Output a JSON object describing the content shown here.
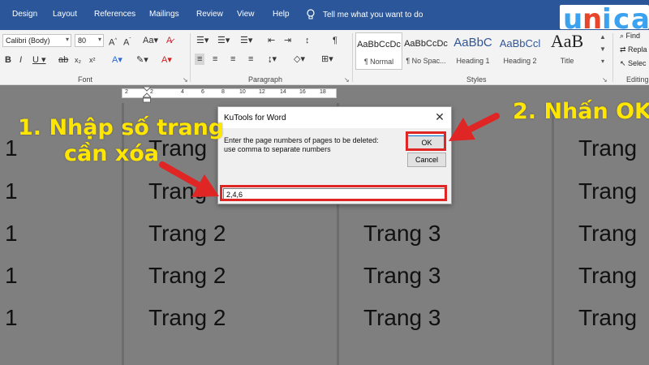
{
  "ribbon_tabs": [
    "Design",
    "Layout",
    "References",
    "Mailings",
    "Review",
    "View",
    "Help"
  ],
  "tell_me": "Tell me what you want to do",
  "logo": {
    "text": "unica",
    "accent": "#3aa2ee"
  },
  "font": {
    "name": "Calibri (Body)",
    "size": "80",
    "group_label": "Font"
  },
  "paragraph": {
    "group_label": "Paragraph"
  },
  "styles": {
    "group_label": "Styles",
    "items": [
      {
        "preview": "AaBbCcDc",
        "name": "¶ Normal"
      },
      {
        "preview": "AaBbCcDc",
        "name": "¶ No Spac..."
      },
      {
        "preview": "AaBbC",
        "name": "Heading 1"
      },
      {
        "preview": "AaBbCcl",
        "name": "Heading 2"
      },
      {
        "preview": "AaB",
        "name": "Title"
      }
    ]
  },
  "editing": {
    "find": "Find",
    "replace": "Repla",
    "select": "Selec",
    "group_label": "Editing"
  },
  "ruler": {
    "numbers": [
      "2",
      "2",
      "4",
      "6",
      "8",
      "10",
      "12",
      "14",
      "16",
      "18"
    ]
  },
  "pages": [
    {
      "lines": [
        "1",
        "1",
        "1",
        "1",
        "1"
      ]
    },
    {
      "lines": [
        "Trang",
        "Trang",
        "Trang 2",
        "Trang 2",
        "Trang 2"
      ]
    },
    {
      "lines": [
        "",
        "",
        "Trang 3",
        "Trang 3",
        "Trang 3"
      ]
    },
    {
      "lines": [
        "Trang",
        "Trang",
        "Trang",
        "Trang",
        "Trang"
      ]
    }
  ],
  "dialog": {
    "title": "KuTools for Word",
    "prompt_line1": "Enter the page numbers of pages to be deleted:",
    "prompt_line2": "use comma to separate numbers",
    "ok": "OK",
    "cancel": "Cancel",
    "input_value": "2,4,6"
  },
  "annotations": {
    "step1_line1": "1. Nhập số trang",
    "step1_line2": "cần xóa",
    "step2": "2. Nhấn OK",
    "color": "#ffe600",
    "arrow_color": "#e02525"
  },
  "colors": {
    "ribbon_blue": "#2b579a",
    "page_gray": "#7f7f7f"
  }
}
